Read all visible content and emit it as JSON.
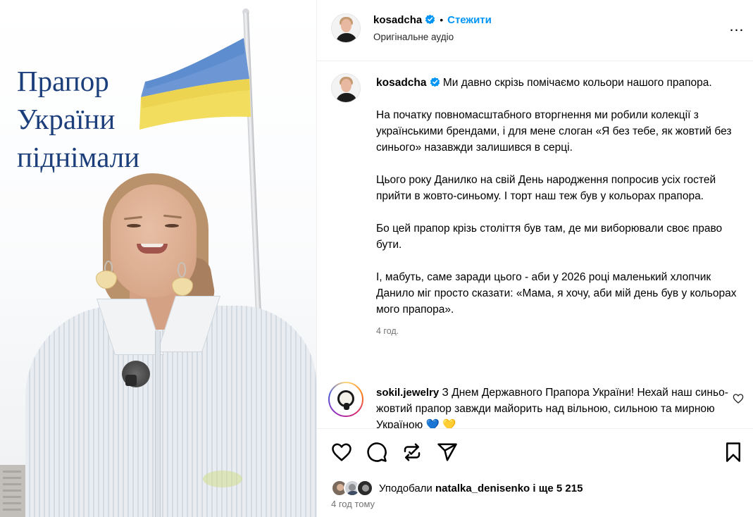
{
  "media": {
    "overlay_lines": [
      "Прапор",
      "України",
      "піднімали"
    ]
  },
  "header": {
    "username": "kosadcha",
    "separator": "•",
    "follow_label": "Стежити",
    "audio_label": "Оригінальне аудіо",
    "more_label": "…"
  },
  "post": {
    "author": "kosadcha",
    "caption_first": "Ми давно скрізь помічаємо кольори нашого прапора.",
    "paragraphs": [
      "На початку повномасштабного вторгнення ми робили колекції з українськими брендами, і для мене слоган «Я без тебе, як жовтий без синього» назавжди залишився в серці.",
      "Цього року Данилко на свій День народження попросив усіх гостей прийти в жовто-синьому. І торт наш теж був у кольорах прапора.",
      "Бо цей прапор крізь століття був там, де ми виборювали своє право бути.",
      "І, мабуть, саме заради цього - аби у 2026 році маленький хлопчик Данило міг просто сказати: «Мама, я хочу, аби мій день був у кольорах мого прапора»."
    ],
    "time": "4 год."
  },
  "comments": [
    {
      "username": "sokil.jewelry",
      "text": "З Днем Державного Прапора України! Нехай наш синьо-жовтий прапор завжди майорить над вільною, сильною та мирною Україною 💙 💛"
    }
  ],
  "likes": {
    "prefix": "Уподобали",
    "user": "natalka_denisenko",
    "conjunction": "і ще",
    "count": "5 215"
  },
  "footer": {
    "timeago": "4 год тому"
  },
  "icons": [
    "verified-badge-icon",
    "more-options-icon",
    "heart-icon",
    "comment-icon",
    "repost-icon",
    "share-icon",
    "bookmark-icon",
    "comment-like-icon"
  ],
  "colors": {
    "accent": "#0095f6",
    "muted": "#737373",
    "overlay_text": "#1c3f7c",
    "flag_blue": "#5b8fd1",
    "flag_yellow": "#f3de63"
  }
}
